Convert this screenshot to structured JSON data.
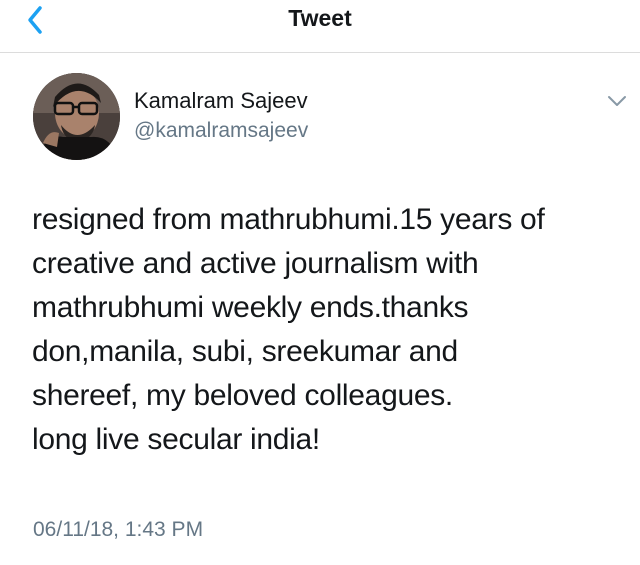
{
  "header": {
    "title": "Tweet",
    "back_icon": "chevron-left-icon",
    "accent_color": "#1da1f2"
  },
  "tweet": {
    "author": {
      "name": "Kamalram Sajeev",
      "handle": "@kamalramsajeev"
    },
    "more_icon": "chevron-down-icon",
    "text_lines": [
      "resigned from mathrubhumi.15 years of",
      "creative and active journalism with",
      "mathrubhumi weekly ends.thanks",
      "don,manila, subi, sreekumar and",
      "shereef, my beloved colleagues.",
      "long live secular india!"
    ],
    "timestamp": "06/11/18, 1:43 PM"
  },
  "colors": {
    "text_primary": "#14171a",
    "text_secondary": "#657786",
    "divider": "#dcdcdc"
  }
}
